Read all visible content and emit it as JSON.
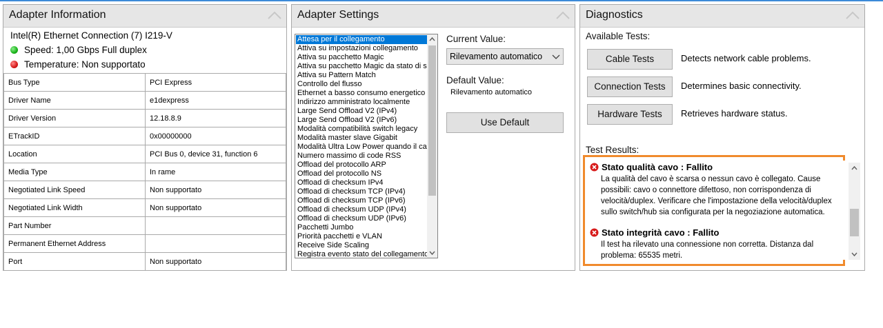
{
  "adapter_info": {
    "title": "Adapter Information",
    "adapter_name": "Intel(R) Ethernet Connection (7) I219-V",
    "speed": "Speed: 1,00 Gbps Full duplex",
    "temperature": "Temperature: Non supportato",
    "rows": [
      {
        "key": "Bus Type",
        "value": "PCI Express"
      },
      {
        "key": "Driver Name",
        "value": "e1dexpress"
      },
      {
        "key": "Driver Version",
        "value": "12.18.8.9"
      },
      {
        "key": "ETrackID",
        "value": "0x00000000"
      },
      {
        "key": "Location",
        "value": "PCI Bus 0, device 31, function 6"
      },
      {
        "key": "Media Type",
        "value": "In rame"
      },
      {
        "key": "Negotiated Link Speed",
        "value": "Non supportato"
      },
      {
        "key": "Negotiated Link Width",
        "value": "Non supportato"
      },
      {
        "key": "Part Number",
        "value": ""
      },
      {
        "key": "Permanent Ethernet Address",
        "value": ""
      },
      {
        "key": "Port",
        "value": "Non supportato"
      }
    ]
  },
  "adapter_settings": {
    "title": "Adapter Settings",
    "properties": [
      "Attesa per il collegamento",
      "Attiva su impostazioni collegamento",
      "Attiva su pacchetto Magic",
      "Attiva su pacchetto Magic da stato di sp",
      "Attiva su Pattern Match",
      "Controllo del flusso",
      "Ethernet a basso consumo energetico",
      "Indirizzo amministrato localmente",
      "Large Send Offload V2 (IPv4)",
      "Large Send Offload V2 (IPv6)",
      "Modalità compatibilità switch legacy",
      "Modalità master slave Gigabit",
      "Modalità Ultra Low Power quando il cavo",
      "Numero massimo di code RSS",
      "Offload del protocollo ARP",
      "Offload del protocollo NS",
      "Offload di checksum IPv4",
      "Offload di checksum TCP (IPv4)",
      "Offload di checksum TCP (IPv6)",
      "Offload di checksum UDP (IPv4)",
      "Offload di checksum UDP (IPv6)",
      "Pacchetti Jumbo",
      "Priorità pacchetti e VLAN",
      "Receive Side Scaling",
      "Registra evento stato del collegamento"
    ],
    "selected_index": 0,
    "current_label": "Current Value:",
    "current_value": "Rilevamento automatico",
    "default_label": "Default Value:",
    "default_value": "Rilevamento automatico",
    "use_default_label": "Use Default"
  },
  "diagnostics": {
    "title": "Diagnostics",
    "available_label": "Available Tests:",
    "tests": [
      {
        "button": "Cable Tests",
        "description": "Detects network cable problems."
      },
      {
        "button": "Connection Tests",
        "description": "Determines basic connectivity."
      },
      {
        "button": "Hardware Tests",
        "description": "Retrieves hardware status."
      }
    ],
    "results_label": "Test Results:",
    "results": [
      {
        "heading": "Stato qualità cavo : Fallito",
        "body": "La qualità del cavo è scarsa o nessun cavo è collegato. Cause possibili: cavo o connettore difettoso, non corrispondenza di velocità/duplex. Verificare che l'impostazione della velocità/duplex sullo switch/hub sia configurata per la negoziazione automatica."
      },
      {
        "heading": "Stato integrità cavo : Fallito",
        "body": "Il test ha rilevato una connessione non corretta. Distanza dal problema: 65535 metri."
      }
    ]
  },
  "colors": {
    "selection": "#0078d7",
    "highlight_frame": "#f08a2c",
    "status_ok": "#19b219",
    "status_error": "#d71a1a"
  }
}
